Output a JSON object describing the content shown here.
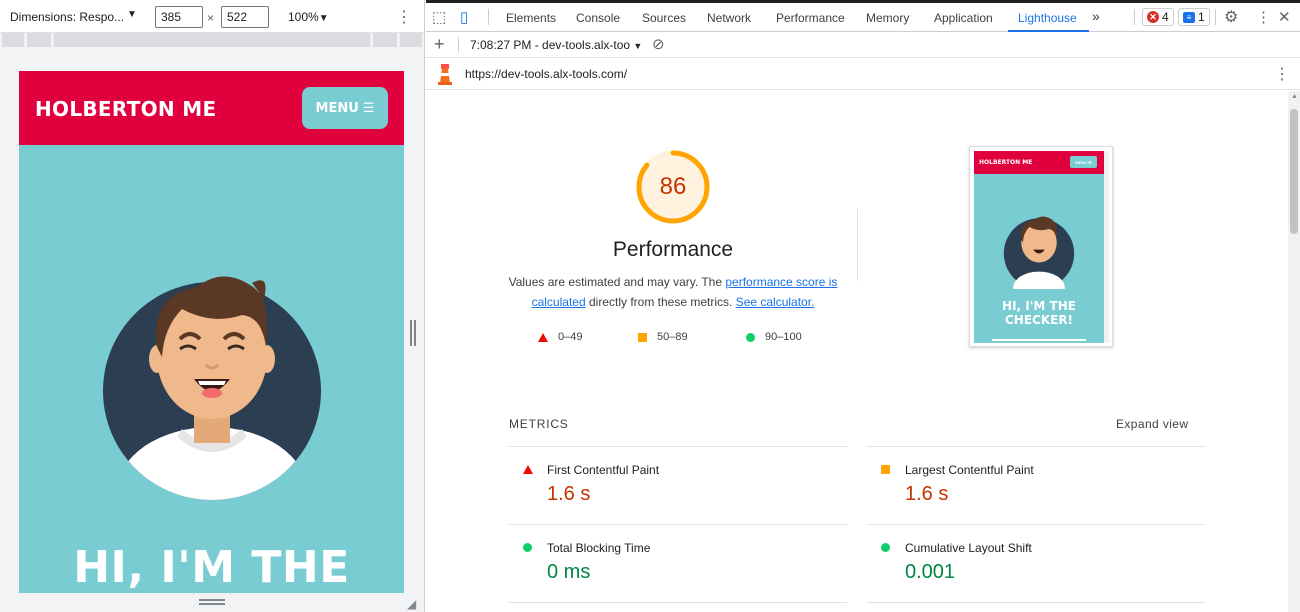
{
  "device_toolbar": {
    "dimensions_label": "Dimensions: Respo...",
    "width_value": "385",
    "height_value": "522",
    "times": "×",
    "zoom": "100%"
  },
  "site": {
    "logo": "HOLBERTON ME",
    "menu_label": "MENU",
    "hero_title": "HI, I'M THE",
    "colors": {
      "header": "#e1003e",
      "body": "#7accd3"
    }
  },
  "devtools": {
    "tabs": [
      {
        "label": "Elements"
      },
      {
        "label": "Console"
      },
      {
        "label": "Sources"
      },
      {
        "label": "Network"
      },
      {
        "label": "Performance"
      },
      {
        "label": "Memory"
      },
      {
        "label": "Application"
      },
      {
        "label": "Lighthouse"
      }
    ],
    "active_tab": "Lighthouse",
    "more_tabs": "»",
    "error_count": "4",
    "message_count": "1",
    "report_selector": "7:08:27 PM - dev-tools.alx-too",
    "url": "https://dev-tools.alx-tools.com/"
  },
  "lighthouse": {
    "score": 86,
    "category_title": "Performance",
    "desc_part1": "Values are estimated and may vary. The ",
    "desc_link1": "performance score is calculated",
    "desc_part2": " directly from these metrics. ",
    "desc_link2": "See calculator.",
    "legend": [
      {
        "shape": "triangle",
        "label": "0–49",
        "color": "#eb0f00"
      },
      {
        "shape": "square",
        "label": "50–89",
        "color": "#ffa400"
      },
      {
        "shape": "circle",
        "label": "90–100",
        "color": "#0cce6b"
      }
    ],
    "screenshot": {
      "logo": "HOLBERTON ME",
      "menu": "MENU ☰",
      "hero": "HI, I'M THE CHECKER!"
    },
    "metrics_label": "METRICS",
    "expand_label": "Expand view",
    "metrics": [
      {
        "name": "First Contentful Paint",
        "value": "1.6 s",
        "rating": "fail"
      },
      {
        "name": "Largest Contentful Paint",
        "value": "1.6 s",
        "rating": "average"
      },
      {
        "name": "Total Blocking Time",
        "value": "0 ms",
        "rating": "pass"
      },
      {
        "name": "Cumulative Layout Shift",
        "value": "0.001",
        "rating": "pass"
      }
    ]
  }
}
